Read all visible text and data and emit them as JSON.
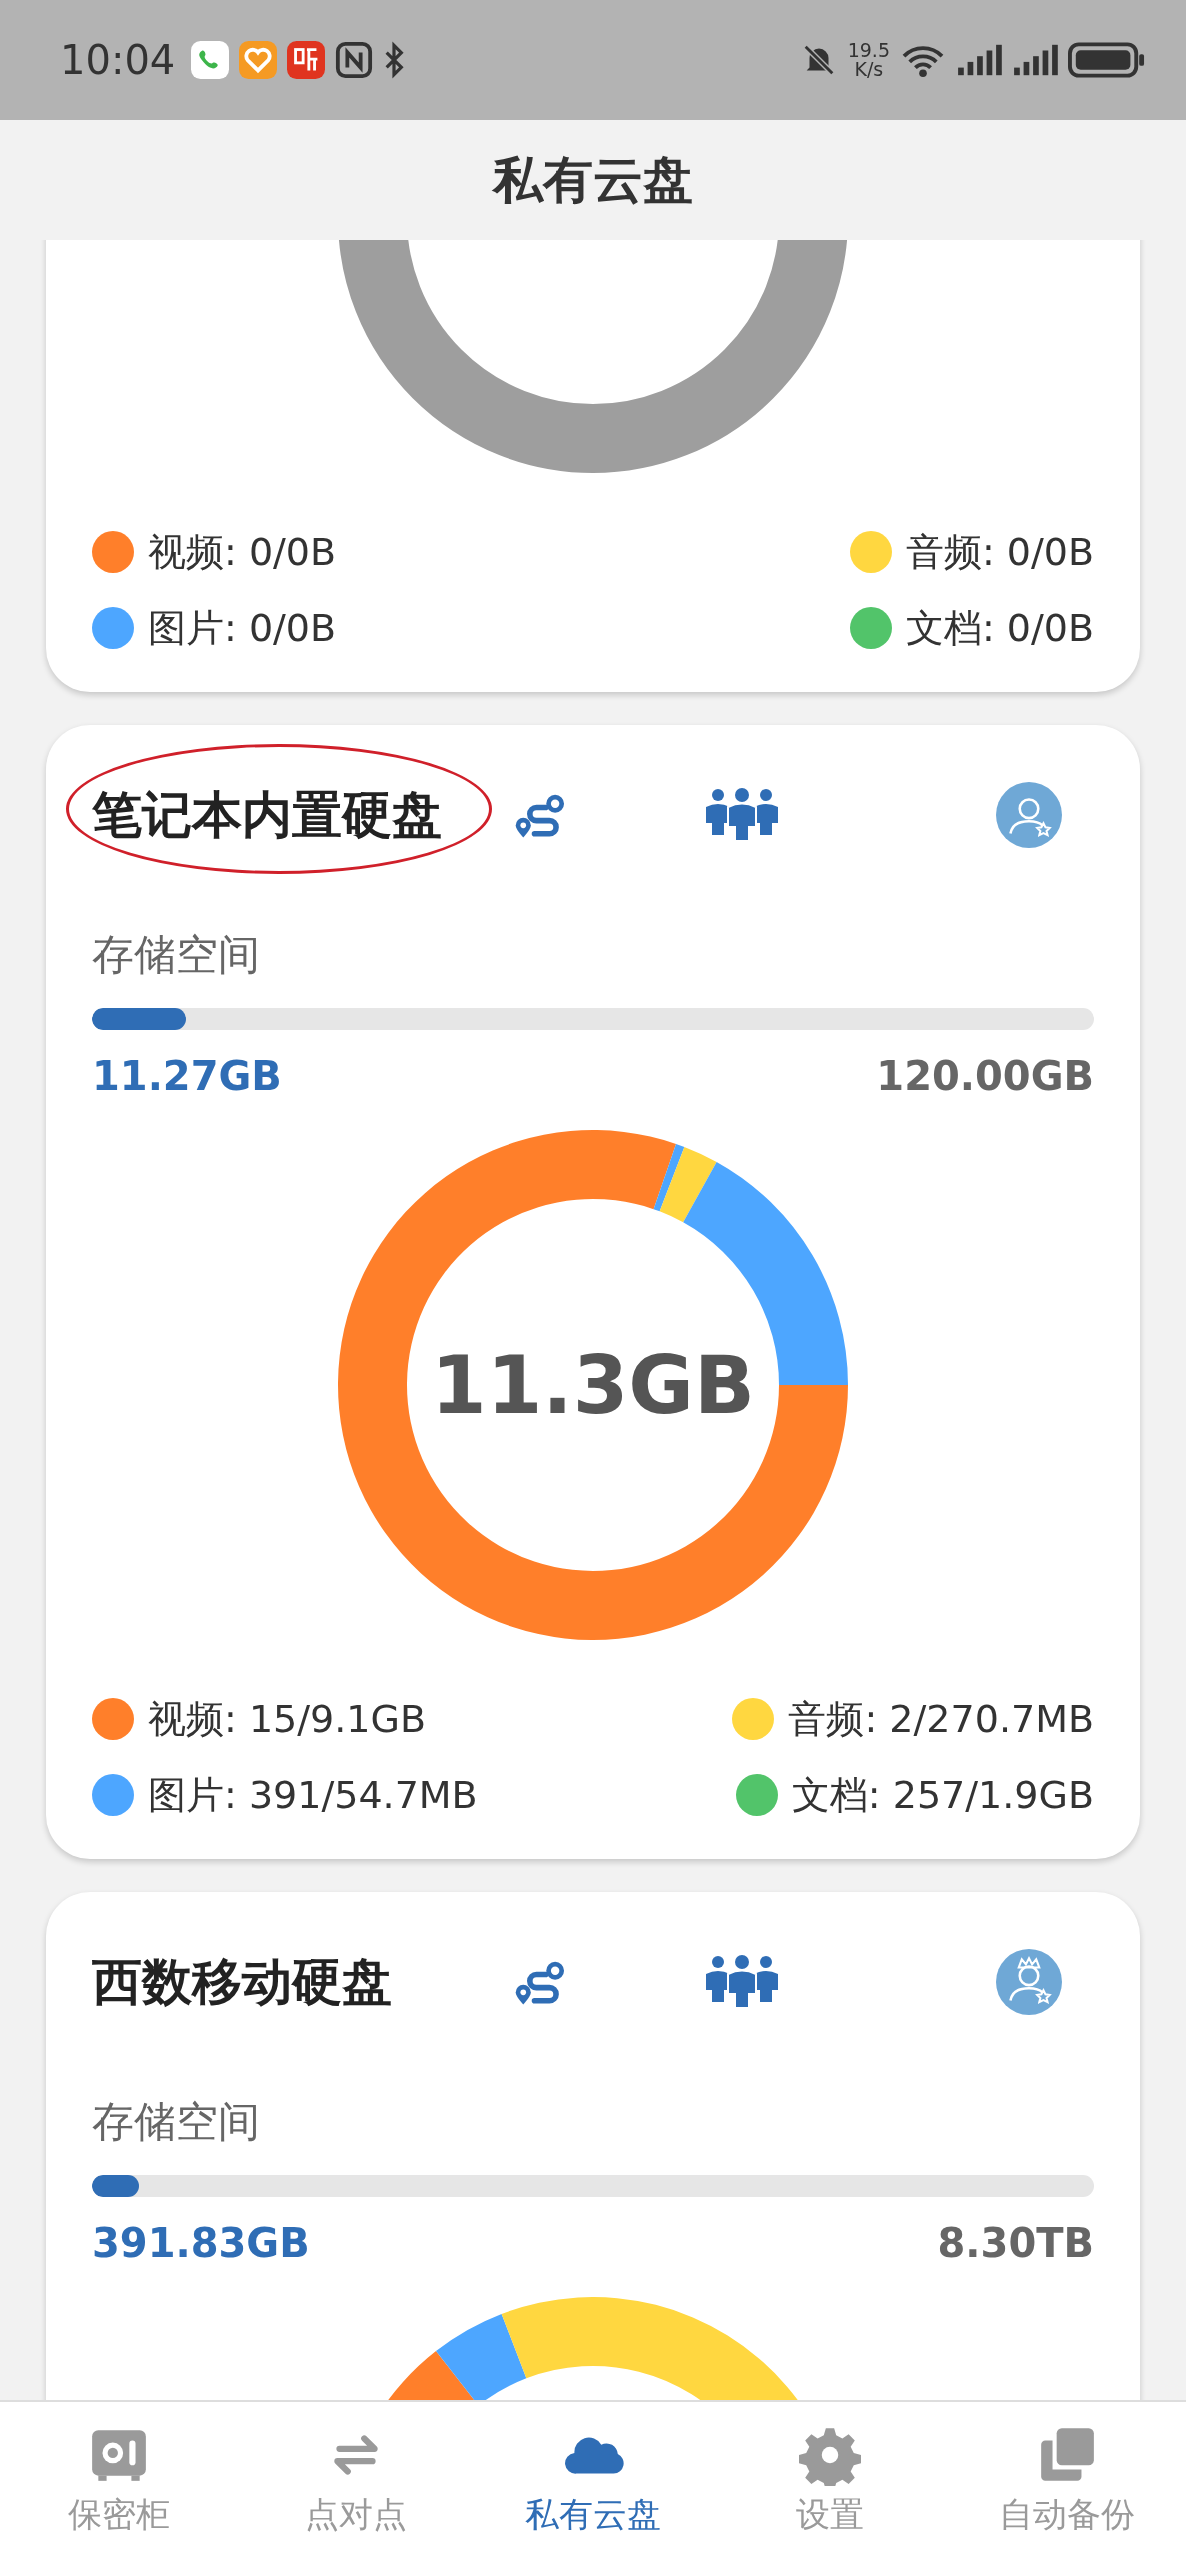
{
  "status_bar": {
    "time": "10:04",
    "net_speed": "19.5",
    "net_unit": "K/s"
  },
  "header": {
    "title": "私有云盘"
  },
  "cards": [
    {
      "legend": [
        {
          "label": "视频: 0/0B",
          "color": "#ff7f2a"
        },
        {
          "label": "音频: 0/0B",
          "color": "#ffd740"
        },
        {
          "label": "图片: 0/0B",
          "color": "#4da6ff"
        },
        {
          "label": "文档: 0/0B",
          "color": "#52c46a"
        }
      ]
    },
    {
      "title": "笔记本内置硬盘",
      "circled": true,
      "storage_label": "存储空间",
      "level": 0.094,
      "used": "11.27GB",
      "total": "120.00GB",
      "center": "11.3GB",
      "legend": [
        {
          "label": "视频: 15/9.1GB",
          "color": "#ff7f2a"
        },
        {
          "label": "音频: 2/270.7MB",
          "color": "#ffd740"
        },
        {
          "label": "图片: 391/54.7MB",
          "color": "#4da6ff"
        },
        {
          "label": "文档: 257/1.9GB",
          "color": "#52c46a"
        }
      ]
    },
    {
      "title": "西数移动硬盘",
      "circled": false,
      "storage_label": "存储空间",
      "level": 0.047,
      "used": "391.83GB",
      "total": "8.30TB"
    }
  ],
  "nav": [
    {
      "label": "保密柜",
      "selected": false
    },
    {
      "label": "点对点",
      "selected": false
    },
    {
      "label": "私有云盘",
      "selected": true
    },
    {
      "label": "设置",
      "selected": false
    },
    {
      "label": "自动备份",
      "selected": false
    }
  ]
}
